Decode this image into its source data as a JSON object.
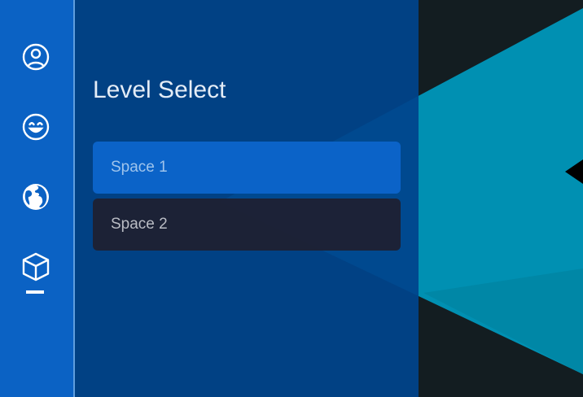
{
  "theme": {
    "sidebar_bg": "#0b62c4",
    "panel_bg": "#00448c",
    "accent": "#0b63c8",
    "scene_teal": "#0090b2",
    "scene_dark": "#131d21"
  },
  "sidebar": {
    "items": [
      {
        "name": "profile",
        "icon": "user-circle-icon",
        "active": false
      },
      {
        "name": "emotes",
        "icon": "smiley-icon",
        "active": false
      },
      {
        "name": "world",
        "icon": "globe-icon",
        "active": false
      },
      {
        "name": "levels",
        "icon": "cube-icon",
        "active": true
      }
    ]
  },
  "panel": {
    "title": "Level Select",
    "levels": [
      {
        "label": "Space 1",
        "selected": true
      },
      {
        "label": "Space 2",
        "selected": false
      }
    ]
  }
}
